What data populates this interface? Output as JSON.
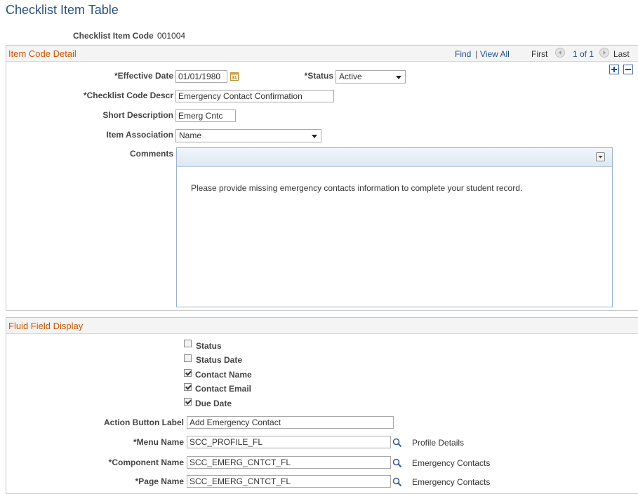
{
  "page": {
    "title": "Checklist Item Table"
  },
  "header": {
    "item_code_label": "Checklist Item Code",
    "item_code_value": "001004"
  },
  "item_code_detail": {
    "section_title": "Item Code Detail",
    "nav": {
      "find": "Find",
      "separator": "|",
      "view_all": "View All",
      "first": "First",
      "counter": "1 of 1",
      "last": "Last"
    },
    "effective_date_label": "*Effective Date",
    "effective_date_value": "01/01/1980",
    "status_label": "*Status",
    "status_value": "Active",
    "checklist_code_descr_label": "*Checklist Code Descr",
    "checklist_code_descr_value": "Emergency Contact Confirmation",
    "short_description_label": "Short Description",
    "short_description_value": "Emerg Cntc",
    "item_association_label": "Item Association",
    "item_association_value": "Name",
    "comments_label": "Comments",
    "comments_value": "Please provide missing emergency contacts information to complete your student record."
  },
  "fluid_field_display": {
    "section_title": "Fluid Field Display",
    "checkboxes": [
      {
        "label": "Status",
        "checked": false
      },
      {
        "label": "Status Date",
        "checked": false
      },
      {
        "label": "Contact Name",
        "checked": true
      },
      {
        "label": "Contact Email",
        "checked": true
      },
      {
        "label": "Due Date",
        "checked": true
      }
    ],
    "action_button_label_label": "Action Button Label",
    "action_button_label_value": "Add Emergency Contact",
    "menu_name_label": "*Menu Name",
    "menu_name_value": "SCC_PROFILE_FL",
    "menu_name_descr": "Profile Details",
    "component_name_label": "*Component Name",
    "component_name_value": "SCC_EMERG_CNTCT_FL",
    "component_name_descr": "Emergency Contacts",
    "page_name_label": "*Page Name",
    "page_name_value": "SCC_EMERG_CNTCT_FL",
    "page_name_descr": "Emergency Contacts"
  },
  "icons": [
    "calendar-icon",
    "add-row-icon",
    "delete-row-icon",
    "previous-icon",
    "next-icon",
    "editor-menu-icon",
    "lookup-icon"
  ]
}
